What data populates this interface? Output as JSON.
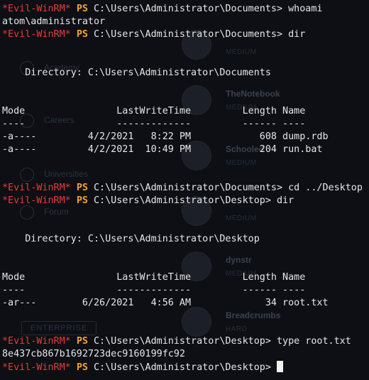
{
  "theme": {
    "background": "#0d0f14",
    "text": "#e7e7e7",
    "prompt_name": "#e63a3a",
    "prompt_ps": "#f2a33a"
  },
  "prompt": {
    "name": "*Evil-WinRM*",
    "ps": "PS"
  },
  "terminal": {
    "line_00": {
      "path": " C:\\Users\\Administrator\\Documents> ",
      "command": "whoami"
    },
    "line_01": "atom\\administrator",
    "line_02": {
      "path": " C:\\Users\\Administrator\\Documents> ",
      "command": "dir"
    },
    "line_03": "",
    "line_04": "",
    "line_05": "    Directory: C:\\Users\\Administrator\\Documents",
    "line_06": "",
    "line_07": "",
    "line_08": "Mode                LastWriteTime         Length Name",
    "line_09": "----                -------------         ------ ----",
    "line_10": "-a----         4/2/2021   8:22 PM            608 dump.rdb",
    "line_11": "-a----         4/2/2021  10:49 PM            204 run.bat",
    "line_12": "",
    "line_13": "",
    "line_14": {
      "path": " C:\\Users\\Administrator\\Documents> ",
      "command": "cd ../Desktop"
    },
    "line_15": {
      "path": " C:\\Users\\Administrator\\Desktop> ",
      "command": "dir"
    },
    "line_16": "",
    "line_17": "",
    "line_18": "    Directory: C:\\Users\\Administrator\\Desktop",
    "line_19": "",
    "line_20": "",
    "line_21": "Mode                LastWriteTime         Length Name",
    "line_22": "----                -------------         ------ ----",
    "line_23": "-ar---        6/26/2021   4:56 AM             34 root.txt",
    "line_24": "",
    "line_25": "",
    "line_26": {
      "path": " C:\\Users\\Administrator\\Desktop> ",
      "command": "type root.txt"
    },
    "line_27": "8e437cb867b1692723dec9160199fc92",
    "line_28": {
      "path": " C:\\Users\\Administrator\\Desktop> ",
      "command": ""
    }
  },
  "background_page": {
    "nav_items": [
      "Academy",
      "Careers",
      "Universities",
      "Forum"
    ],
    "cards": [
      {
        "title": "TheNotebook",
        "subtitle": "MEDIUM"
      },
      {
        "title": "Schooled",
        "subtitle": "MEDIUM"
      },
      {
        "title": "",
        "subtitle": "MEDIUM"
      },
      {
        "title": "dynstr",
        "subtitle": "MEDIUM"
      },
      {
        "title": "Breadcrumbs",
        "subtitle": "HARD"
      }
    ],
    "first_card_subtitle": "MEDIUM",
    "button_label": "ENTERPRISE"
  }
}
